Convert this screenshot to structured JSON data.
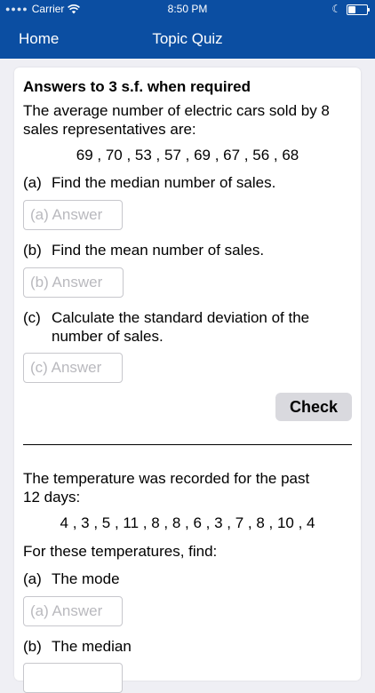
{
  "status": {
    "carrier": "Carrier",
    "time": "8:50 PM"
  },
  "nav": {
    "home": "Home",
    "title": "Topic Quiz"
  },
  "q1": {
    "heading": "Answers to 3 s.f. when required",
    "line1": "The average number of electric cars sold by 8",
    "line2": "sales representatives are:",
    "data": "69 , 70 , 53 , 57 , 69 , 67 , 56 , 68",
    "a": {
      "label": "(a)",
      "text": "Find the median number of sales.",
      "placeholder": "(a) Answer"
    },
    "b": {
      "label": "(b)",
      "text": "Find the mean number of sales.",
      "placeholder": "(b) Answer"
    },
    "c": {
      "label": "(c)",
      "text1": "Calculate the standard deviation of the",
      "text2": "number of sales.",
      "placeholder": "(c) Answer"
    },
    "check": "Check"
  },
  "q2": {
    "line1": "The temperature was recorded for the past",
    "line2": "12 days:",
    "data": "4 , 3 , 5 , 11 , 8 , 8 , 6 , 3 , 7 , 8 , 10 , 4",
    "prompt": "For these temperatures, find:",
    "a": {
      "label": "(a)",
      "text": "The mode",
      "placeholder": "(a) Answer"
    },
    "b": {
      "label": "(b)",
      "text": "The median"
    }
  }
}
